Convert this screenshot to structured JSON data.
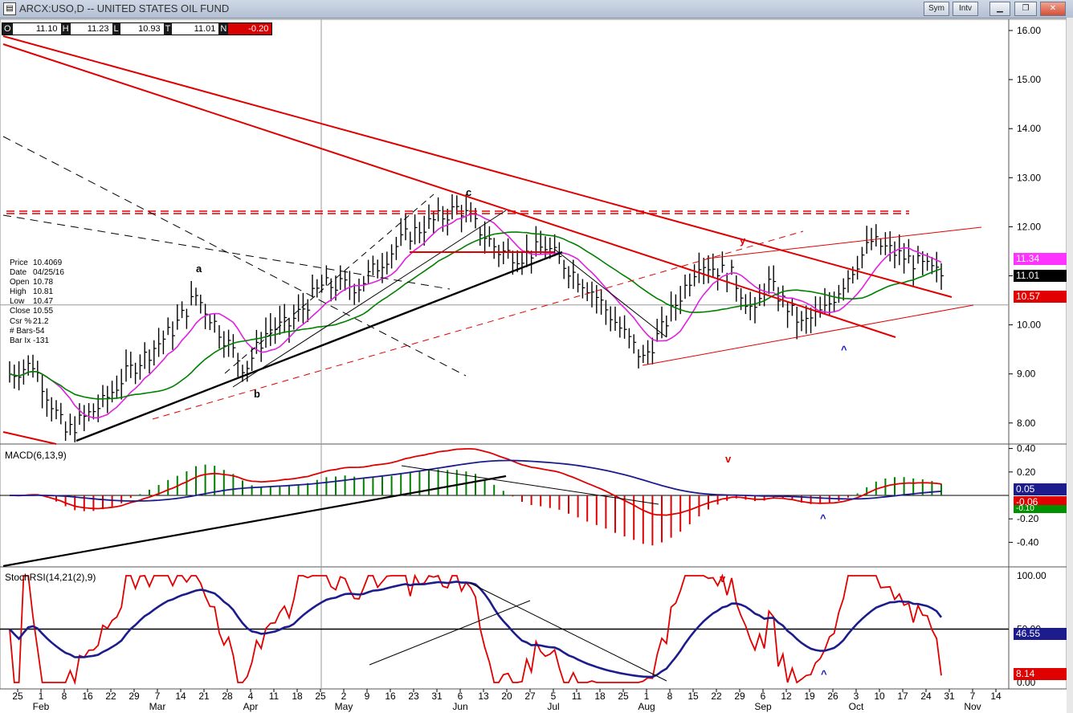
{
  "window": {
    "title": "ARCX:USO,D -- UNITED STATES OIL FUND",
    "icon": "chart-app-icon",
    "buttons": [
      "Sym",
      "Intv"
    ]
  },
  "ohlc_bar": [
    {
      "key": "O",
      "value": "11.10"
    },
    {
      "key": "H",
      "value": "11.23"
    },
    {
      "key": "L",
      "value": "10.93"
    },
    {
      "key": "T",
      "value": "11.01"
    },
    {
      "key": "N",
      "value": "-0.20"
    }
  ],
  "info_box": [
    {
      "label": "Price",
      "value": "10.4069"
    },
    {
      "label": "Date",
      "value": "04/25/16"
    },
    {
      "label": "Open",
      "value": "10.78"
    },
    {
      "label": "High",
      "value": "10.81"
    },
    {
      "label": "Low",
      "value": "10.47"
    },
    {
      "label": "Close",
      "value": "10.55"
    },
    {
      "label": "Csr %",
      "value": "21.2"
    },
    {
      "label": "# Bars",
      "value": "-54"
    },
    {
      "label": "Bar Ix",
      "value": "-131"
    }
  ],
  "price_tags": [
    {
      "value": "11.34",
      "bg": "#ff33ff",
      "fg": "#ffffff"
    },
    {
      "value": "11.01",
      "bg": "#000000",
      "fg": "#ffffff"
    },
    {
      "value": "10.57",
      "bg": "#e00000",
      "fg": "#ffffff"
    }
  ],
  "macd_tags": [
    {
      "value": "0.05",
      "bg": "#1c1c8c",
      "fg": "#ffffff"
    },
    {
      "value": "-0.06",
      "bg": "#e00000",
      "fg": "#ffffff"
    },
    {
      "value": "-0.10",
      "bg": "#009000",
      "fg": "#ffffff"
    }
  ],
  "stoch_tags": [
    {
      "value": "46.55",
      "bg": "#1c1c8c",
      "fg": "#ffffff"
    },
    {
      "value": "8.14",
      "bg": "#e00000",
      "fg": "#ffffff"
    }
  ],
  "panels": {
    "macd_label": "MACD(6,13,9)",
    "stoch_label": "StochRSI(14,21(2),9)"
  },
  "annotations": [
    "a",
    "b",
    "c",
    "y",
    "^",
    "v",
    "^",
    "v",
    "^"
  ],
  "colors": {
    "red": "#e00000",
    "green": "#008000",
    "magenta": "#e020e0",
    "navy": "#1c1c8c",
    "black": "#000000"
  },
  "chart_data": [
    {
      "type": "line",
      "title": "ARCX:USO,D -- UNITED STATES OIL FUND",
      "ylim": [
        7.6,
        16.3
      ],
      "yticks": [
        "16.00",
        "15.00",
        "14.00",
        "13.00",
        "12.00",
        "11.00",
        "10.00",
        "9.00",
        "8.00"
      ],
      "xticks": [
        "25",
        "1",
        "8",
        "16",
        "22",
        "29",
        "7",
        "14",
        "21",
        "28",
        "4",
        "11",
        "18",
        "25",
        "2",
        "9",
        "16",
        "23",
        "31",
        "6",
        "13",
        "20",
        "27",
        "5",
        "11",
        "18",
        "25",
        "1",
        "8",
        "15",
        "22",
        "29",
        "6",
        "12",
        "19",
        "26",
        "3",
        "10",
        "17",
        "24",
        "31",
        "7",
        "14"
      ],
      "months": [
        "Feb",
        "Mar",
        "Apr",
        "May",
        "Jun",
        "Jul",
        "Aug",
        "Sep",
        "Oct",
        "Nov"
      ],
      "close_keypoints": [
        {
          "date": "Jan 25",
          "value": 9.0
        },
        {
          "date": "Feb 1",
          "value": 9.2
        },
        {
          "date": "Feb 11",
          "value": 7.8
        },
        {
          "date": "Feb 22",
          "value": 8.4
        },
        {
          "date": "Mar 1",
          "value": 9.0
        },
        {
          "date": "Mar 14",
          "value": 9.9
        },
        {
          "date": "Mar 21",
          "value": 10.6
        },
        {
          "date": "Apr 5",
          "value": 9.1
        },
        {
          "date": "Apr 12",
          "value": 9.9
        },
        {
          "date": "Apr 18",
          "value": 10.0
        },
        {
          "date": "Apr 28",
          "value": 10.8
        },
        {
          "date": "May 9",
          "value": 10.8
        },
        {
          "date": "May 23",
          "value": 11.8
        },
        {
          "date": "Jun 8",
          "value": 12.4
        },
        {
          "date": "Jun 20",
          "value": 11.5
        },
        {
          "date": "Jun 27",
          "value": 11.4
        },
        {
          "date": "Jul 5",
          "value": 11.6
        },
        {
          "date": "Jul 18",
          "value": 10.7
        },
        {
          "date": "Aug 2",
          "value": 9.3
        },
        {
          "date": "Aug 8",
          "value": 9.9
        },
        {
          "date": "Aug 19",
          "value": 11.3
        },
        {
          "date": "Aug 29",
          "value": 11.0
        },
        {
          "date": "Sep 6",
          "value": 10.2
        },
        {
          "date": "Sep 9",
          "value": 10.9
        },
        {
          "date": "Sep 19",
          "value": 10.0
        },
        {
          "date": "Sep 26",
          "value": 10.3
        },
        {
          "date": "Oct 10",
          "value": 11.7
        },
        {
          "date": "Oct 19",
          "value": 11.4
        },
        {
          "date": "Oct 31",
          "value": 11.01
        }
      ]
    },
    {
      "type": "line",
      "title": "MACD(6,13,9)",
      "ylim": [
        -0.5,
        0.4
      ],
      "yticks": [
        "0.40",
        "0.20",
        "-0.20",
        "-0.40"
      ],
      "series": []
    },
    {
      "type": "line",
      "title": "StochRSI(14,21(2),9)",
      "ylim": [
        0,
        100
      ],
      "yticks": [
        "100.00",
        "50.00",
        "0.00"
      ],
      "series": []
    }
  ]
}
